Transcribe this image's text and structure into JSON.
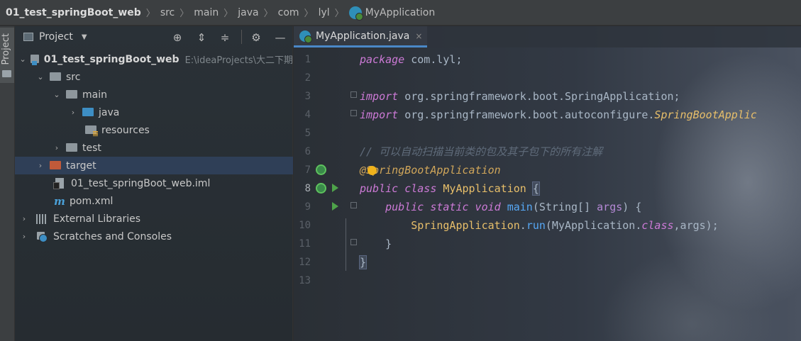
{
  "breadcrumb": [
    "01_test_springBoot_web",
    "src",
    "main",
    "java",
    "com",
    "lyl",
    "MyApplication"
  ],
  "strip": {
    "project_label": "Project"
  },
  "project_panel": {
    "title": "Project",
    "tree": [
      {
        "label": "01_test_springBoot_web",
        "path": "E:\\ideaProjects\\大二下期"
      },
      {
        "label": "src"
      },
      {
        "label": "main"
      },
      {
        "label": "java"
      },
      {
        "label": "resources"
      },
      {
        "label": "test"
      },
      {
        "label": "target"
      },
      {
        "label": "01_test_springBoot_web.iml"
      },
      {
        "label": "pom.xml"
      },
      {
        "label": "External Libraries"
      },
      {
        "label": "Scratches and Consoles"
      }
    ]
  },
  "editor": {
    "tab": {
      "label": "MyApplication.java"
    },
    "line_numbers": [
      "1",
      "2",
      "3",
      "4",
      "5",
      "6",
      "7",
      "8",
      "9",
      "10",
      "11",
      "12",
      "13"
    ],
    "code": {
      "l1_kw": "package",
      "l1_rest": " com.lyl;",
      "l3_kw": "import",
      "l3_rest": " org.springframework.boot.SpringApplication;",
      "l4_kw": "import",
      "l4_rest": " org.springframework.boot.autoconfigure.",
      "l4_cls": "SpringBootApplic",
      "l6_comment": "// 可以自动扫描当前类的包及其子包下的所有注解",
      "l7_ann": "@SpringBootApplication",
      "l8_kw": "public class",
      "l8_name": " MyApplication ",
      "l8_brace": "{",
      "l9_kw": "    public static void",
      "l9_fn": " main",
      "l9_p1": "(String[] ",
      "l9_param": "args",
      "l9_p2": ") {",
      "l10_cls": "        SpringApplication",
      "l10_dot": ".",
      "l10_fn": "run",
      "l10_p1": "(MyApplication.",
      "l10_kw": "class",
      "l10_p2": ",args);",
      "l11": "    }",
      "l12": "}"
    }
  }
}
